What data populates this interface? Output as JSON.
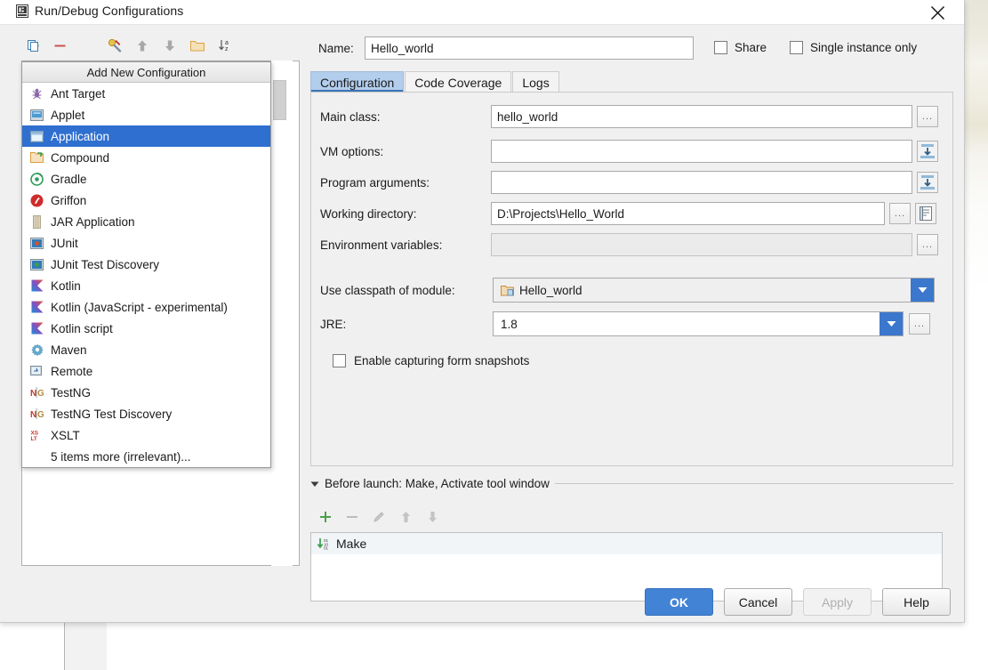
{
  "window": {
    "title": "Run/Debug Configurations",
    "icon": "run-debug-icon",
    "close_icon": "close-icon"
  },
  "tree_toolbar": {
    "buttons": [
      {
        "name": "add-configuration-button",
        "icon": "plus-icon",
        "color": "#4d9e4d"
      },
      {
        "name": "remove-configuration-button",
        "icon": "minus-icon",
        "color": "#c9534f"
      },
      {
        "name": "copy-configuration-button",
        "icon": "copy-icon",
        "color": "#3c7fb1"
      },
      {
        "name": "edit-templates-button",
        "icon": "wrench-icon",
        "color": "#d8a13a"
      },
      {
        "name": "move-up-button",
        "icon": "arrow-up-icon",
        "color": "#9a9a9a"
      },
      {
        "name": "move-down-button",
        "icon": "arrow-down-icon",
        "color": "#9a9a9a"
      },
      {
        "name": "new-folder-button",
        "icon": "folder-icon",
        "color": "#d9a441"
      },
      {
        "name": "sort-alphabetically-button",
        "icon": "sort-az-icon",
        "color": "#555555"
      }
    ]
  },
  "popup": {
    "title": "Add New Configuration",
    "items": [
      {
        "label": "Ant Target",
        "icon": "ant-icon",
        "selected": false
      },
      {
        "label": "Applet",
        "icon": "applet-icon",
        "selected": false
      },
      {
        "label": "Application",
        "icon": "application-icon",
        "selected": true
      },
      {
        "label": "Compound",
        "icon": "compound-icon",
        "selected": false
      },
      {
        "label": "Gradle",
        "icon": "gradle-icon",
        "selected": false
      },
      {
        "label": "Griffon",
        "icon": "griffon-icon",
        "selected": false
      },
      {
        "label": "JAR Application",
        "icon": "jar-icon",
        "selected": false
      },
      {
        "label": "JUnit",
        "icon": "junit-icon",
        "selected": false
      },
      {
        "label": "JUnit Test Discovery",
        "icon": "junit-icon",
        "selected": false
      },
      {
        "label": "Kotlin",
        "icon": "kotlin-icon",
        "selected": false
      },
      {
        "label": "Kotlin (JavaScript - experimental)",
        "icon": "kotlin-icon",
        "selected": false
      },
      {
        "label": "Kotlin script",
        "icon": "kotlin-icon",
        "selected": false
      },
      {
        "label": "Maven",
        "icon": "maven-icon",
        "selected": false
      },
      {
        "label": "Remote",
        "icon": "remote-icon",
        "selected": false
      },
      {
        "label": "TestNG",
        "icon": "testng-icon",
        "selected": false
      },
      {
        "label": "TestNG Test Discovery",
        "icon": "testng-icon",
        "selected": false
      },
      {
        "label": "XSLT",
        "icon": "xslt-icon",
        "selected": false
      },
      {
        "label": "5 items more (irrelevant)...",
        "icon": "",
        "selected": false
      }
    ]
  },
  "config": {
    "name_label": "Name:",
    "name_value": "Hello_world",
    "share_label": "Share",
    "share_checked": false,
    "single_instance_label": "Single instance only",
    "single_instance_checked": false,
    "tabs": [
      {
        "label": "Configuration",
        "active": true
      },
      {
        "label": "Code Coverage",
        "active": false
      },
      {
        "label": "Logs",
        "active": false
      }
    ],
    "fields": {
      "main_class_label": "Main class:",
      "main_class_value": "hello_world",
      "main_class_browse_icon": "ellipsis-icon",
      "vm_options_label": "VM options:",
      "vm_options_value": "",
      "vm_options_expand_icon": "expand-editor-icon",
      "program_arguments_label": "Program arguments:",
      "program_arguments_value": "",
      "program_arguments_expand_icon": "expand-editor-icon",
      "working_directory_label": "Working directory:",
      "working_directory_value": "D:\\Projects\\Hello_World",
      "working_directory_browse_icon": "ellipsis-icon",
      "working_directory_macro_icon": "macros-icon",
      "environment_variables_label": "Environment variables:",
      "environment_variables_value": "",
      "environment_variables_browse_icon": "ellipsis-icon",
      "classpath_label": "Use classpath of module:",
      "classpath_value": "Hello_world",
      "classpath_icon": "module-icon",
      "jre_label": "JRE:",
      "jre_value": "1.8",
      "jre_browse_icon": "ellipsis-icon",
      "snapshots_label": "Enable capturing form snapshots",
      "snapshots_checked": false
    }
  },
  "before_launch": {
    "header": "Before launch: Make, Activate tool window",
    "collapse_icon": "triangle-down-icon",
    "toolbar": [
      {
        "name": "add-task-button",
        "icon": "plus-icon",
        "color": "#4d9e4d"
      },
      {
        "name": "remove-task-button",
        "icon": "minus-icon",
        "color": "#b5b5b5"
      },
      {
        "name": "edit-task-button",
        "icon": "pencil-icon",
        "color": "#b5b5b5"
      },
      {
        "name": "move-task-up-button",
        "icon": "arrow-up-icon",
        "color": "#b5b5b5"
      },
      {
        "name": "move-task-down-button",
        "icon": "arrow-down-icon",
        "color": "#b5b5b5"
      }
    ],
    "rows": [
      {
        "label": "Make",
        "icon": "make-icon"
      }
    ]
  },
  "footer": {
    "ok": "OK",
    "cancel": "Cancel",
    "apply": "Apply",
    "help": "Help",
    "apply_enabled": false
  },
  "colors": {
    "selection_blue": "#2f6fd0",
    "primary_button": "#4383d6",
    "tab_active": "#b3cdec",
    "tab_underline": "#3c74b5",
    "dialog_bg": "#f0f0f0"
  }
}
